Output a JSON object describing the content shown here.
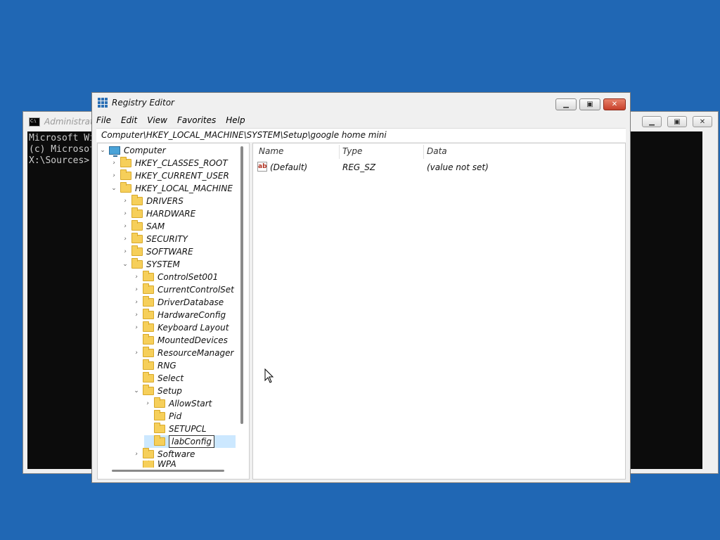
{
  "cmd": {
    "title": "Administrator",
    "lines": [
      "Microsoft Wi",
      "(c) Microsof",
      "",
      "X:\\Sources>"
    ]
  },
  "regedit": {
    "title": "Registry Editor",
    "menu": [
      "File",
      "Edit",
      "View",
      "Favorites",
      "Help"
    ],
    "address": "Computer\\HKEY_LOCAL_MACHINE\\SYSTEM\\Setup\\google home mini",
    "tree": {
      "computer": "Computer",
      "hkcr": "HKEY_CLASSES_ROOT",
      "hkcu": "HKEY_CURRENT_USER",
      "hklm": "HKEY_LOCAL_MACHINE",
      "drivers": "DRIVERS",
      "hardware": "HARDWARE",
      "sam": "SAM",
      "security": "SECURITY",
      "software": "SOFTWARE",
      "system": "SYSTEM",
      "controlset001": "ControlSet001",
      "currentcontrolset": "CurrentControlSet",
      "driverdatabase": "DriverDatabase",
      "hardwareconfig": "HardwareConfig",
      "keyboardlayout": "Keyboard Layout",
      "mounteddevices": "MountedDevices",
      "resourcemanager": "ResourceManager",
      "rng": "RNG",
      "select": "Select",
      "setup": "Setup",
      "allowstart": "AllowStart",
      "pid": "Pid",
      "setupcl": "SETUPCL",
      "labconfig": "labConfig",
      "software2": "Software",
      "wpa": "WPA"
    },
    "columns": {
      "name": "Name",
      "type": "Type",
      "data": "Data"
    },
    "values": [
      {
        "name": "(Default)",
        "type": "REG_SZ",
        "data": "(value not set)"
      }
    ]
  }
}
